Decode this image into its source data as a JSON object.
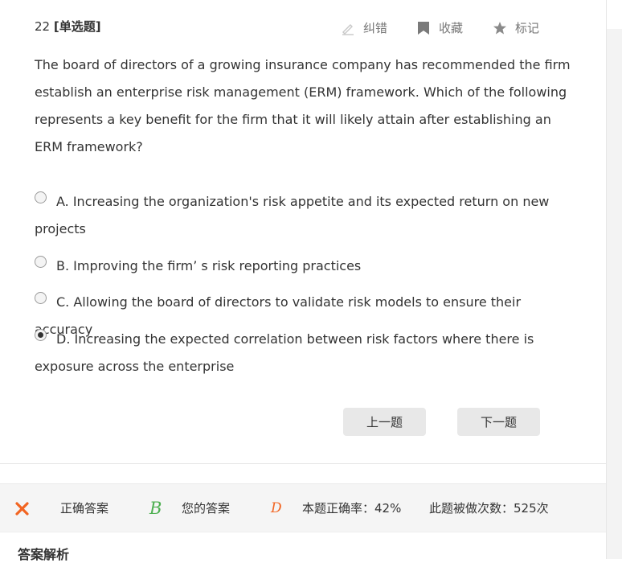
{
  "question": {
    "number": "22",
    "type_label": "[单选题]",
    "text": "The board of directors of a growing insurance company has recommended the firm establish an enterprise risk management (ERM) framework. Which of the following represents a key benefit for the firm that it will likely attain after establishing an ERM framework?"
  },
  "tools": {
    "correct_label": "纠错",
    "favorite_label": "收藏",
    "mark_label": "标记"
  },
  "options": [
    {
      "text": "A. Increasing the organization's risk appetite and its expected return on new projects",
      "selected": false
    },
    {
      "text": "B. Improving the firm’ s risk reporting practices",
      "selected": false
    },
    {
      "text": "C. Allowing the board of directors to validate risk models to ensure their accuracy",
      "selected": false
    },
    {
      "text": "D. Increasing the expected correlation between risk factors where there is exposure across the enterprise",
      "selected": true
    }
  ],
  "nav": {
    "prev_label": "上一题",
    "next_label": "下一题"
  },
  "result": {
    "status_icon": "close-icon",
    "correct_answer_label": "正确答案",
    "correct_answer": "B",
    "your_answer_label": "您的答案",
    "your_answer": "D",
    "accuracy_text": "本题正确率：42%",
    "attempts_text": "此题被做次数：525次"
  },
  "analysis": {
    "title": "答案解析"
  },
  "colors": {
    "wrong": "#f26522",
    "correct": "#4caf50",
    "button_bg": "#e8e8e8"
  }
}
